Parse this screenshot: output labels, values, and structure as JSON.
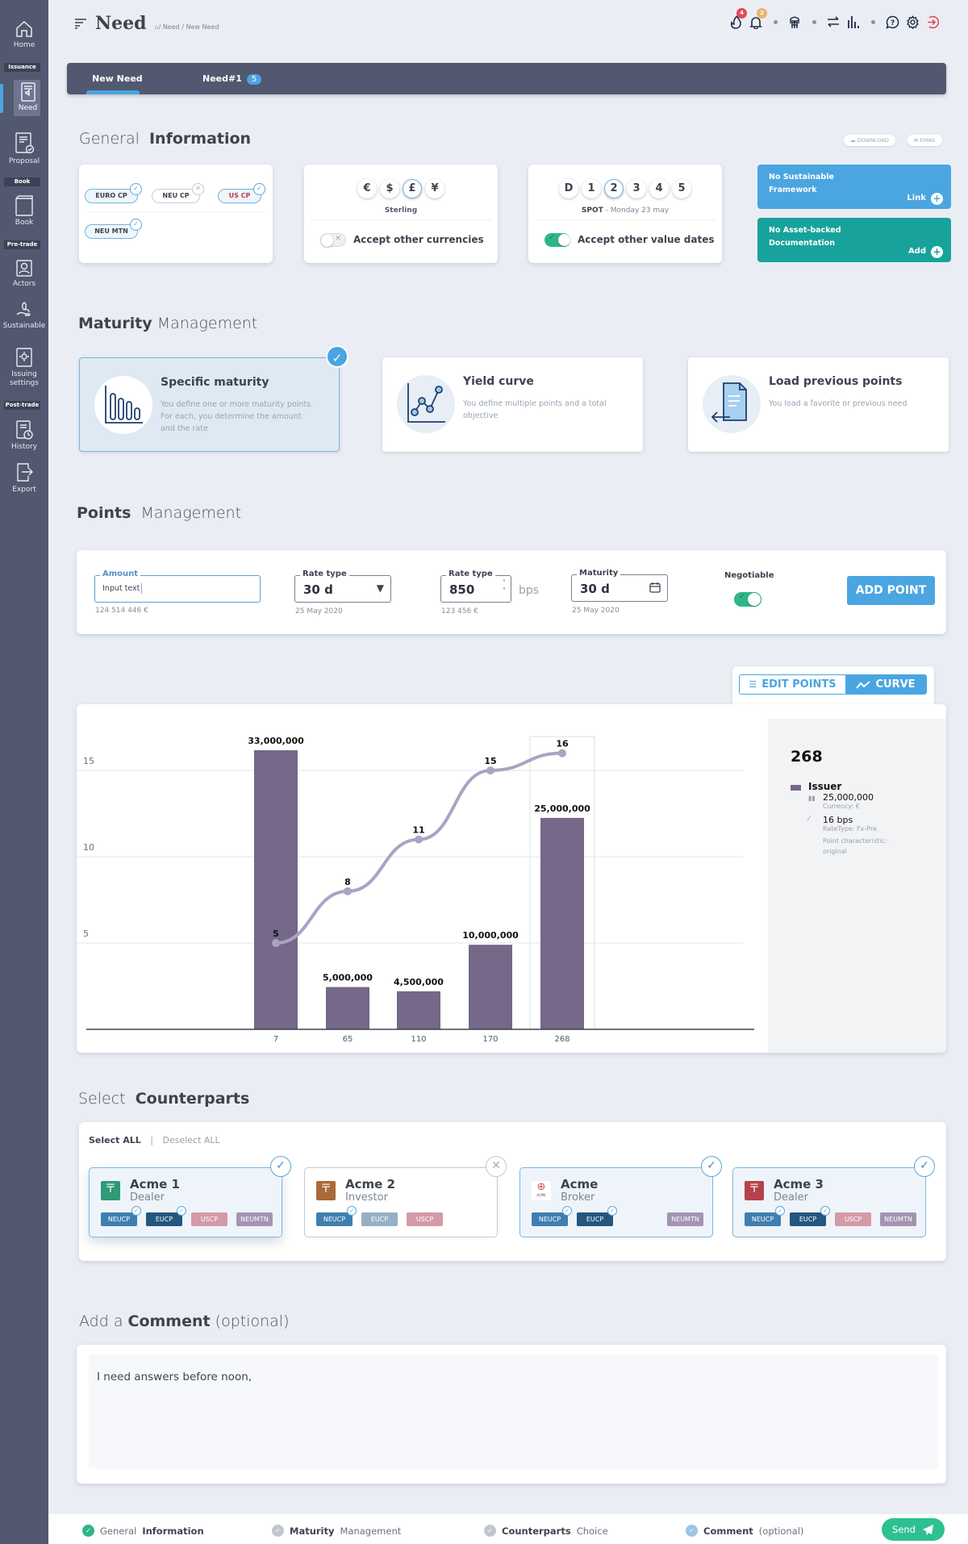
{
  "sidebar": {
    "items": [
      {
        "label": "Home",
        "icon": "home-icon"
      },
      {
        "label": "Need",
        "icon": "need-icon"
      },
      {
        "label": "Proposal",
        "icon": "proposal-icon"
      },
      {
        "label": "Book",
        "icon": "book-icon"
      },
      {
        "label": "Actors",
        "icon": "actors-icon"
      },
      {
        "label": "Sustainable",
        "icon": "sustainable-icon"
      },
      {
        "label": "Issuing settings",
        "icon": "issuing-settings-icon"
      },
      {
        "label": "History",
        "icon": "history-icon"
      },
      {
        "label": "Export",
        "icon": "export-icon"
      }
    ],
    "sections": [
      "Issuance",
      "Book",
      "Pre-trade",
      "Post-trade"
    ],
    "active": "Need"
  },
  "header": {
    "title": "Need",
    "breadcrumb": "/ Need / New Need",
    "badges": {
      "fire": "4",
      "bell": "2"
    }
  },
  "tabs": [
    {
      "label": "New Need",
      "active": true
    },
    {
      "label": "Need#1",
      "count": "5"
    }
  ],
  "general": {
    "title_light": "General",
    "title_bold": "Information",
    "download_label": "DOWNLOAD",
    "email_label": "EMAIL",
    "programs": [
      {
        "label": "EURO CP",
        "selected": true
      },
      {
        "label": "NEU CP",
        "selected": false
      },
      {
        "label": "US CP",
        "selected": true,
        "color": "#c0394f"
      },
      {
        "label": "NEU MTN",
        "selected": true
      }
    ],
    "currencies": [
      "€",
      "$",
      "£",
      "¥"
    ],
    "selected_currency": "£",
    "currency_name": "Sterling",
    "accept_currencies_label": "Accept other currencies",
    "accept_currencies": false,
    "value_dates": [
      "D",
      "1",
      "2",
      "3",
      "4",
      "5"
    ],
    "selected_value_date": "2",
    "spot_label": "SPOT",
    "spot_date": "- Monday 23 may",
    "accept_dates_label": "Accept other value dates",
    "accept_dates": true,
    "sustainable": {
      "text": "No Sustainable Framework",
      "action": "Link",
      "color": "#4aa5e0"
    },
    "asset_backed": {
      "text": "No Asset-backed Documentation",
      "action": "Add",
      "color": "#17a39b"
    }
  },
  "maturity": {
    "title_bold": "Maturity",
    "title_light": "Management",
    "options": [
      {
        "title": "Specific maturity",
        "desc": "You define one or more maturity points. For each, you determine the amount and the rate",
        "selected": true
      },
      {
        "title": "Yield curve",
        "desc": "You define multiple points and a total objective",
        "selected": false
      },
      {
        "title": "Load previous points",
        "desc": "You load a favorite or previous need",
        "selected": false
      }
    ]
  },
  "points": {
    "title_bold": "Points",
    "title_light": "Management",
    "amount": {
      "label": "Amount",
      "value": "Input text",
      "hint": "124 514 446 €"
    },
    "rate_type": {
      "label": "Rate type",
      "value": "30 d",
      "hint": "25 May 2020"
    },
    "rate_value": {
      "label": "Rate type",
      "value": "850",
      "unit": "bps",
      "hint": "123 456 €"
    },
    "maturity": {
      "label": "Maturity",
      "value": "30 d",
      "hint": "25 May 2020"
    },
    "negotiable_label": "Negotiable",
    "negotiable": true,
    "add_point_label": "ADD POINT",
    "view_toggle": {
      "edit_label": "EDIT POINTS",
      "curve_label": "CURVE",
      "active": "CURVE"
    }
  },
  "chart_data": {
    "type": "bar",
    "categories": [
      "7",
      "65",
      "110",
      "170",
      "268"
    ],
    "series": [
      {
        "name": "Amount",
        "kind": "bar",
        "values": [
          33000000,
          5000000,
          4500000,
          10000000,
          25000000
        ],
        "labels": [
          "33,000,000",
          "5,000,000",
          "4,500,000",
          "10,000,000",
          "25,000,000"
        ],
        "color": "#766888"
      },
      {
        "name": "Rate (bps)",
        "kind": "line",
        "values": [
          5,
          8,
          11,
          15,
          16
        ],
        "color": "#aba3c2"
      }
    ],
    "y_ticks": [
      5,
      10,
      15
    ],
    "ylim": [
      0,
      17
    ],
    "bar_max": 33000000,
    "highlight_category": "268",
    "grid": true,
    "xlabel": "",
    "ylabel": ""
  },
  "detail": {
    "maturity": "268",
    "party": "Issuer",
    "amount": "25,000,000",
    "currency": "Currency: €",
    "rate": "16 bps",
    "rate_type": "RateType: Fx-Pre",
    "characteristic": "Point characteristic: original"
  },
  "counterparts": {
    "title_light": "Select",
    "title_bold": "Counterparts",
    "select_all": "Select ALL",
    "deselect_all": "Deselect ALL",
    "items": [
      {
        "name": "Acme 1",
        "role": "Dealer",
        "selected": true,
        "logo_color": "#2f9a75",
        "tags": [
          {
            "label": "NEUCP",
            "cls": "t-neucp",
            "checked": true
          },
          {
            "label": "EUCP",
            "cls": "t-eucp",
            "checked": true
          },
          {
            "label": "USCP",
            "cls": "t-uscp"
          },
          {
            "label": "NEUMTN",
            "cls": "t-neumtn"
          }
        ]
      },
      {
        "name": "Acme 2",
        "role": "Investor",
        "selected": false,
        "logo_color": "#a86a3a",
        "tags": [
          {
            "label": "NEUCP",
            "cls": "t-neucp",
            "checked": true
          },
          {
            "label": "EUCP",
            "cls": "t-eucp-off"
          },
          {
            "label": "USCP",
            "cls": "t-uscp"
          }
        ]
      },
      {
        "name": "Acme",
        "role": "Broker",
        "selected": true,
        "logo_color": "#ffffff",
        "tags": [
          {
            "label": "NEUCP",
            "cls": "t-neucp",
            "checked": true
          },
          {
            "label": "EUCP",
            "cls": "t-eucp",
            "checked": true
          },
          {
            "label": "NEUMTN",
            "cls": "t-neumtn",
            "slot": 3
          }
        ]
      },
      {
        "name": "Acme 3",
        "role": "Dealer",
        "selected": true,
        "logo_color": "#b5424a",
        "tags": [
          {
            "label": "NEUCP",
            "cls": "t-neucp",
            "checked": true
          },
          {
            "label": "EUCP",
            "cls": "t-eucp",
            "checked": true
          },
          {
            "label": "USCP",
            "cls": "t-uscp"
          },
          {
            "label": "NEUMTN",
            "cls": "t-neumtn"
          }
        ]
      }
    ]
  },
  "comment": {
    "title_light": "Add a",
    "title_bold": "Comment",
    "title_suffix": "(optional)",
    "value": "I need answers before noon,"
  },
  "footer": {
    "steps": [
      {
        "light": "General",
        "bold": "Information",
        "bold_first": false,
        "status": "done",
        "color": "#2fb58a"
      },
      {
        "light": "Management",
        "bold": "Maturity",
        "bold_first": true,
        "status": "pending",
        "color": "#c2c6ce"
      },
      {
        "light": "Choice",
        "bold": "Counterparts",
        "bold_first": true,
        "status": "pending",
        "color": "#c2c6ce"
      },
      {
        "light": "(optional)",
        "bold": "Comment",
        "bold_first": true,
        "status": "optional",
        "color": "#9ac6e8"
      }
    ],
    "send_label": "Send"
  }
}
